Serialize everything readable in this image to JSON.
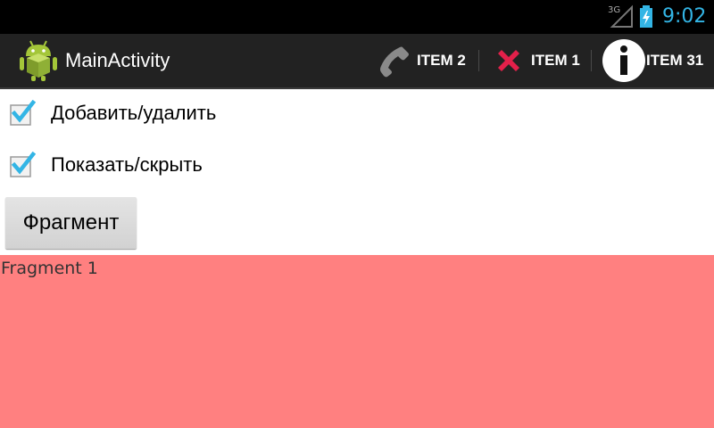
{
  "status_bar": {
    "network": "3G",
    "clock": "9:02",
    "accent_color": "#33b5e5"
  },
  "action_bar": {
    "app_icon": "android-icon",
    "title": "MainActivity",
    "items": [
      {
        "label": "ITEM 2",
        "icon": "phone-icon"
      },
      {
        "label": "ITEM 1",
        "icon": "close-icon"
      },
      {
        "label": "ITEM 31",
        "icon": "info-icon"
      }
    ]
  },
  "content": {
    "checkboxes": [
      {
        "label": "Добавить/удалить",
        "checked": true
      },
      {
        "label": "Показать/скрыть",
        "checked": true
      }
    ],
    "button_label": "Фрагмент",
    "fragment": {
      "text": "Fragment 1",
      "background": "#ff8080"
    }
  }
}
